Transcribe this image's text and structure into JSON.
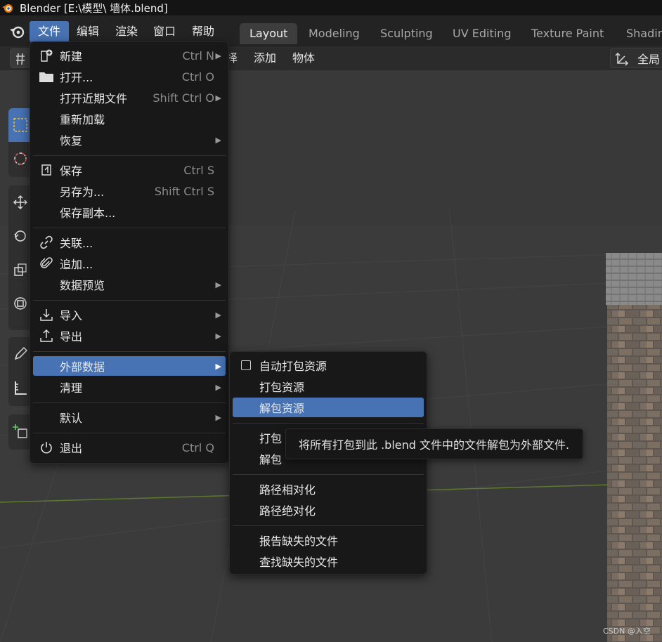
{
  "window": {
    "title": "Blender [E:\\模型\\ 墙体.blend]"
  },
  "topbar": {
    "menus": [
      "文件",
      "编辑",
      "渲染",
      "窗口",
      "帮助"
    ],
    "workspaces": [
      "Layout",
      "Modeling",
      "Sculpting",
      "UV Editing",
      "Texture Paint",
      "Shadin"
    ]
  },
  "header": {
    "select_partial": "择",
    "add": "添加",
    "object": "物体",
    "global": "全局"
  },
  "file_menu": {
    "items": [
      {
        "label": "新建",
        "shortcut": "Ctrl N",
        "icon": "new-file-icon",
        "submenu": true
      },
      {
        "label": "打开...",
        "shortcut": "Ctrl O",
        "icon": "folder-icon"
      },
      {
        "label": "打开近期文件",
        "shortcut": "Shift Ctrl O",
        "submenu": true
      },
      {
        "label": "重新加载"
      },
      {
        "label": "恢复",
        "submenu": true
      },
      {
        "label": "保存",
        "shortcut": "Ctrl S",
        "icon": "save-icon"
      },
      {
        "label": "另存为...",
        "shortcut": "Shift Ctrl S"
      },
      {
        "label": "保存副本..."
      },
      {
        "label": "关联...",
        "icon": "link-icon"
      },
      {
        "label": "追加...",
        "icon": "paperclip-icon"
      },
      {
        "label": "数据预览",
        "submenu": true
      },
      {
        "label": "导入",
        "icon": "import-icon",
        "submenu": true
      },
      {
        "label": "导出",
        "icon": "export-icon",
        "submenu": true
      },
      {
        "label": "外部数据",
        "submenu": true,
        "highlighted": true
      },
      {
        "label": "清理",
        "submenu": true
      },
      {
        "label": "默认",
        "submenu": true
      },
      {
        "label": "退出",
        "shortcut": "Ctrl Q",
        "icon": "power-icon"
      }
    ]
  },
  "external_data_menu": {
    "items": [
      {
        "label": "自动打包资源",
        "checkbox": true
      },
      {
        "label": "打包资源"
      },
      {
        "label": "解包资源",
        "highlighted": true
      },
      {
        "label": "打包"
      },
      {
        "label": "解包"
      },
      {
        "label": "路径相对化"
      },
      {
        "label": "路径绝对化"
      },
      {
        "label": "报告缺失的文件"
      },
      {
        "label": "查找缺失的文件"
      }
    ]
  },
  "tooltip": {
    "text": "将所有打包到此 .blend 文件中的文件解包为外部文件."
  },
  "watermark": {
    "text": "CSDN @入空"
  },
  "colors": {
    "accent": "#4772b3",
    "menu_bg": "#181818",
    "viewport_bg": "#3a3a3a"
  }
}
